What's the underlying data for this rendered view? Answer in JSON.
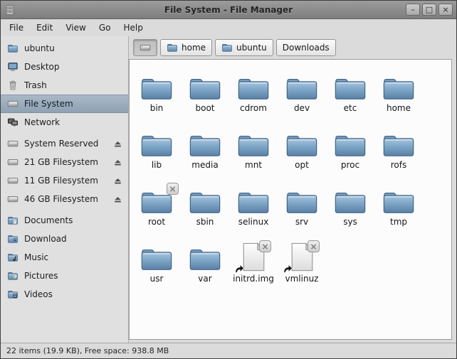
{
  "window": {
    "title": "File System - File Manager",
    "controls": {
      "minimize": "–",
      "maximize": "□",
      "close": "×"
    }
  },
  "menu": {
    "items": [
      "File",
      "Edit",
      "View",
      "Go",
      "Help"
    ]
  },
  "toolbar": {
    "path_buttons": [
      {
        "name": "file-system",
        "label": "",
        "icon": "drive-icon",
        "pressed": true
      },
      {
        "name": "home",
        "label": "home",
        "icon": "folder-icon",
        "pressed": false
      },
      {
        "name": "ubuntu",
        "label": "ubuntu",
        "icon": "folder-icon",
        "pressed": false
      },
      {
        "name": "downloads",
        "label": "Downloads",
        "icon": null,
        "pressed": false
      }
    ]
  },
  "sidebar": {
    "groups": [
      {
        "name": "places",
        "items": [
          {
            "label": "ubuntu",
            "icon": "home-folder-icon"
          },
          {
            "label": "Desktop",
            "icon": "desktop-icon"
          },
          {
            "label": "Trash",
            "icon": "trash-icon"
          },
          {
            "label": "File System",
            "icon": "drive-icon",
            "selected": true
          },
          {
            "label": "Network",
            "icon": "network-icon"
          }
        ]
      },
      {
        "name": "devices",
        "items": [
          {
            "label": "System Reserved",
            "icon": "drive-icon",
            "eject": true
          },
          {
            "label": "21 GB Filesystem",
            "icon": "drive-icon",
            "eject": true
          },
          {
            "label": "11 GB Filesystem",
            "icon": "drive-icon",
            "eject": true
          },
          {
            "label": "46 GB Filesystem",
            "icon": "drive-icon",
            "eject": true
          }
        ]
      },
      {
        "name": "user-folders",
        "items": [
          {
            "label": "Documents",
            "icon": "folder-documents-icon"
          },
          {
            "label": "Download",
            "icon": "folder-download-icon"
          },
          {
            "label": "Music",
            "icon": "folder-music-icon"
          },
          {
            "label": "Pictures",
            "icon": "folder-pictures-icon"
          },
          {
            "label": "Videos",
            "icon": "folder-videos-icon"
          }
        ]
      }
    ]
  },
  "files": [
    {
      "name": "bin",
      "type": "folder"
    },
    {
      "name": "boot",
      "type": "folder"
    },
    {
      "name": "cdrom",
      "type": "folder"
    },
    {
      "name": "dev",
      "type": "folder"
    },
    {
      "name": "etc",
      "type": "folder"
    },
    {
      "name": "home",
      "type": "folder"
    },
    {
      "name": "lib",
      "type": "folder"
    },
    {
      "name": "media",
      "type": "folder"
    },
    {
      "name": "mnt",
      "type": "folder"
    },
    {
      "name": "opt",
      "type": "folder"
    },
    {
      "name": "proc",
      "type": "folder"
    },
    {
      "name": "rofs",
      "type": "folder"
    },
    {
      "name": "root",
      "type": "folder",
      "emblems": [
        "no-access"
      ]
    },
    {
      "name": "sbin",
      "type": "folder"
    },
    {
      "name": "selinux",
      "type": "folder"
    },
    {
      "name": "srv",
      "type": "folder"
    },
    {
      "name": "sys",
      "type": "folder"
    },
    {
      "name": "tmp",
      "type": "folder"
    },
    {
      "name": "usr",
      "type": "folder"
    },
    {
      "name": "var",
      "type": "folder"
    },
    {
      "name": "initrd.img",
      "type": "file",
      "emblems": [
        "symlink",
        "no-access"
      ]
    },
    {
      "name": "vmlinuz",
      "type": "file",
      "emblems": [
        "symlink",
        "no-access"
      ]
    }
  ],
  "statusbar": {
    "text": "22 items (19.9 KB), Free space: 938.8 MB"
  },
  "colors": {
    "folder_blue": "#6f96b8",
    "selection": "#98a9b9",
    "titlebar_gray": "#8e8e8e",
    "window_bg": "#dbdbdb",
    "view_bg": "#fcfcfc"
  }
}
